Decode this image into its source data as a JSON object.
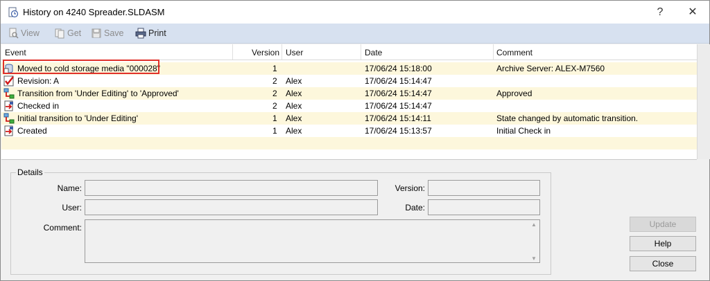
{
  "window": {
    "title": "History on 4240 Spreader.SLDASM",
    "help_glyph": "?",
    "close_glyph": "✕"
  },
  "toolbar": {
    "view": "View",
    "get": "Get",
    "save": "Save",
    "print": "Print"
  },
  "columns": {
    "event": "Event",
    "version": "Version",
    "user": "User",
    "date": "Date",
    "comment": "Comment"
  },
  "rows": [
    {
      "event": "Moved to cold storage media \"000028\"",
      "version": "1",
      "user": "",
      "date": "17/06/24 15:18:00",
      "comment": "Archive Server: ALEX-M7560",
      "icon": "cold-storage-icon"
    },
    {
      "event": "Revision: A",
      "version": "2",
      "user": "Alex",
      "date": "17/06/24 15:14:47",
      "comment": "",
      "icon": "revision-check-icon"
    },
    {
      "event": "Transition from 'Under Editing' to 'Approved'",
      "version": "2",
      "user": "Alex",
      "date": "17/06/24 15:14:47",
      "comment": "Approved",
      "icon": "workflow-transition-icon"
    },
    {
      "event": "Checked in",
      "version": "2",
      "user": "Alex",
      "date": "17/06/24 15:14:47",
      "comment": "",
      "icon": "check-in-icon"
    },
    {
      "event": "Initial transition to 'Under Editing'",
      "version": "1",
      "user": "Alex",
      "date": "17/06/24 15:14:11",
      "comment": "State changed by automatic transition.",
      "icon": "workflow-transition-icon"
    },
    {
      "event": "Created",
      "version": "1",
      "user": "Alex",
      "date": "17/06/24 15:13:57",
      "comment": "Initial Check in",
      "icon": "check-in-icon"
    }
  ],
  "details": {
    "legend": "Details",
    "name_label": "Name:",
    "user_label": "User:",
    "comment_label": "Comment:",
    "version_label": "Version:",
    "date_label": "Date:",
    "name_value": "",
    "user_value": "",
    "version_value": "",
    "date_value": "",
    "comment_value": ""
  },
  "buttons": {
    "update": "Update",
    "help": "Help",
    "close": "Close"
  },
  "colors": {
    "toolbar_bg": "#d7e1f0",
    "row_alt": "#fdf7dc",
    "highlight_box": "#e0302a"
  }
}
